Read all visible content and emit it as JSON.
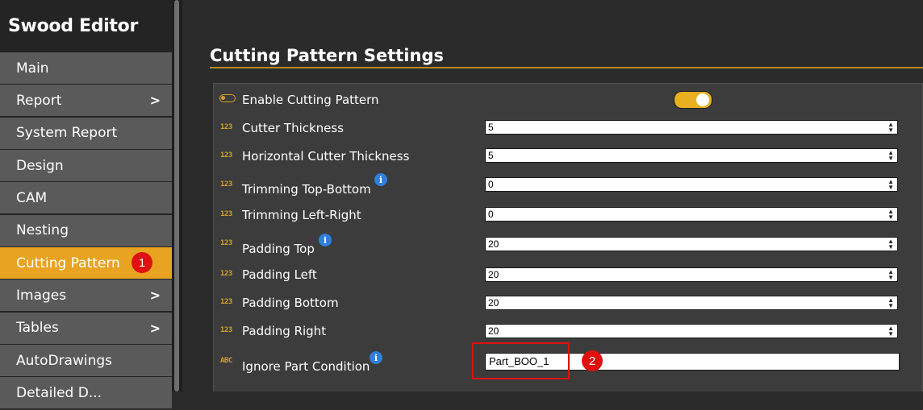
{
  "app_title": "Swood Editor",
  "sidebar": {
    "items": [
      {
        "label": "Main",
        "has_chevron": false
      },
      {
        "label": "Report",
        "has_chevron": true
      },
      {
        "label": "System Report",
        "has_chevron": false
      },
      {
        "label": "Design",
        "has_chevron": false
      },
      {
        "label": "CAM",
        "has_chevron": false
      },
      {
        "label": "Nesting",
        "has_chevron": false
      },
      {
        "label": "Cutting Pattern",
        "has_chevron": false,
        "active": true
      },
      {
        "label": "Images",
        "has_chevron": true
      },
      {
        "label": "Tables",
        "has_chevron": true
      },
      {
        "label": "AutoDrawings",
        "has_chevron": false
      },
      {
        "label": "Detailed D...",
        "has_chevron": false
      }
    ],
    "chevron": ">"
  },
  "annotations": {
    "badge1": "1",
    "badge2": "2"
  },
  "main": {
    "title": "Cutting Pattern Settings",
    "enable": {
      "label": "Enable Cutting Pattern",
      "value": true
    },
    "number_icon": "123",
    "text_icon": "ABC",
    "info_glyph": "i",
    "fields": [
      {
        "label": "Cutter Thickness",
        "value": "5"
      },
      {
        "label": "Horizontal Cutter Thickness",
        "value": "5"
      },
      {
        "label": "Trimming Top-Bottom",
        "value": "0"
      },
      {
        "label": "Trimming Left-Right",
        "value": "0"
      },
      {
        "label": "Padding Top",
        "value": "20"
      },
      {
        "label": "Padding Left",
        "value": "20"
      },
      {
        "label": "Padding Bottom",
        "value": "20"
      },
      {
        "label": "Padding Right",
        "value": "20"
      }
    ],
    "condition": {
      "label": "Ignore Part Condition",
      "value": "Part_BOO_1"
    }
  },
  "colors": {
    "accent": "#e8a321",
    "badge": "#e01010",
    "info": "#2f7fe0"
  }
}
